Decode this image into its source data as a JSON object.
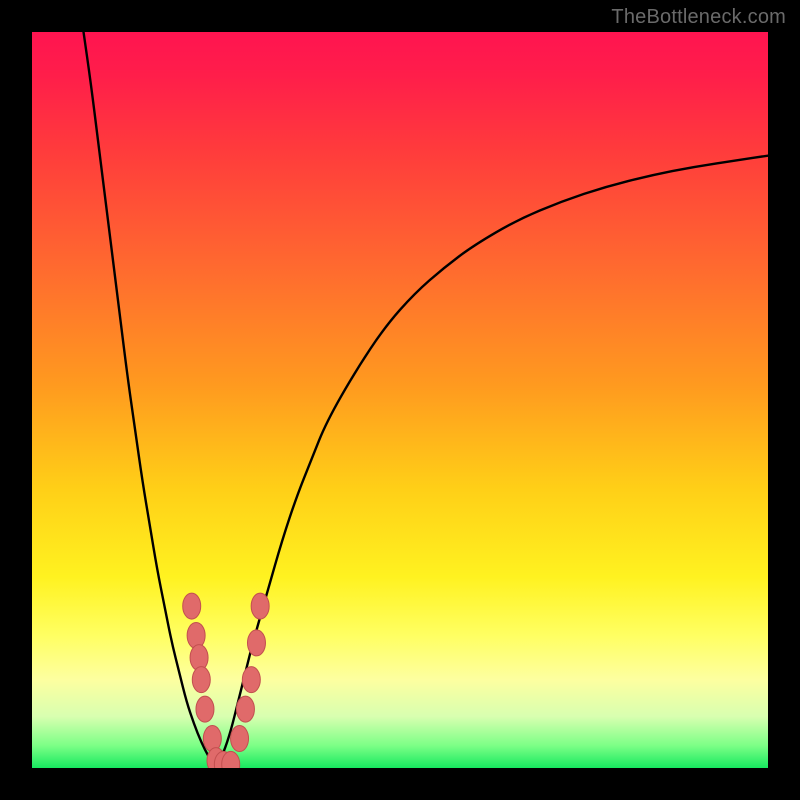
{
  "watermark": {
    "text": "TheBottleneck.com"
  },
  "colors": {
    "curve": "#000000",
    "marker_fill": "#e06a6a",
    "marker_stroke": "#c24f4f",
    "frame": "#000000"
  },
  "chart_data": {
    "type": "line",
    "title": "",
    "xlabel": "",
    "ylabel": "",
    "xlim": [
      0,
      100
    ],
    "ylim": [
      0,
      100
    ],
    "grid": false,
    "legend": false,
    "series": [
      {
        "name": "left-curve",
        "x": [
          7,
          8,
          9,
          10,
          11,
          12,
          13,
          14,
          15,
          16,
          17,
          18,
          19,
          20,
          21,
          22,
          23,
          24,
          25
        ],
        "y": [
          100,
          93,
          85,
          77,
          69,
          61,
          53,
          46,
          39,
          33,
          27,
          22,
          17,
          13,
          9,
          6,
          3.5,
          1.5,
          0
        ]
      },
      {
        "name": "right-curve",
        "x": [
          25,
          26,
          27,
          28,
          29,
          30,
          32,
          34,
          36,
          38,
          40,
          44,
          48,
          52,
          56,
          60,
          66,
          72,
          78,
          84,
          90,
          96,
          100
        ],
        "y": [
          0,
          2,
          5,
          9,
          13,
          17,
          24,
          31,
          37,
          42,
          47,
          54,
          60,
          64.5,
          68,
          71,
          74.5,
          77,
          79,
          80.5,
          81.7,
          82.6,
          83.2
        ]
      }
    ],
    "markers": {
      "name": "bead-markers",
      "points": [
        {
          "x": 21.7,
          "y": 22
        },
        {
          "x": 22.3,
          "y": 18
        },
        {
          "x": 22.7,
          "y": 15
        },
        {
          "x": 23.0,
          "y": 12
        },
        {
          "x": 23.5,
          "y": 8
        },
        {
          "x": 24.5,
          "y": 4
        },
        {
          "x": 25.0,
          "y": 1
        },
        {
          "x": 26.0,
          "y": 0.5
        },
        {
          "x": 27.0,
          "y": 0.5
        },
        {
          "x": 28.2,
          "y": 4
        },
        {
          "x": 29.0,
          "y": 8
        },
        {
          "x": 29.8,
          "y": 12
        },
        {
          "x": 30.5,
          "y": 17
        },
        {
          "x": 31.0,
          "y": 22
        }
      ]
    }
  }
}
